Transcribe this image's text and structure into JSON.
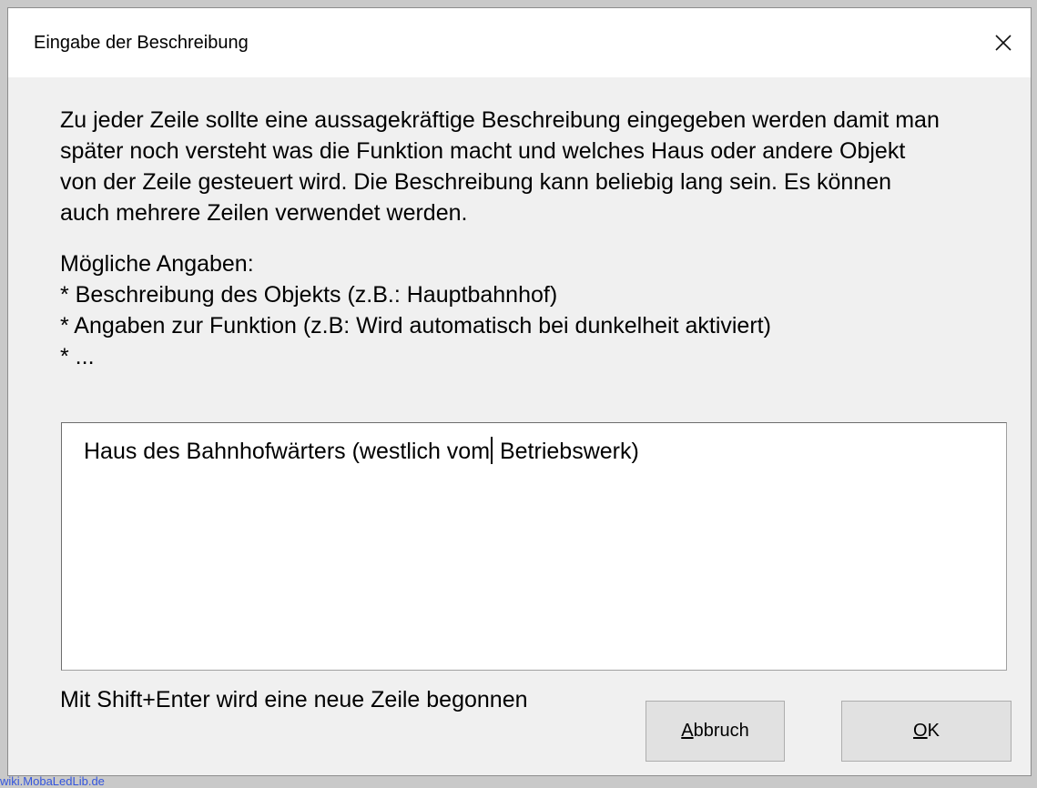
{
  "window": {
    "title": "Eingabe der Beschreibung",
    "close_icon": "close-icon"
  },
  "description": {
    "lines": [
      "Zu jeder Zeile sollte eine aussagekräftige Beschreibung eingegeben werden damit man",
      "später noch versteht was die Funktion macht und welches Haus oder andere Objekt",
      "von der Zeile gesteuert wird. Die Beschreibung kann beliebig lang sein. Es können",
      "auch mehrere Zeilen verwendet werden."
    ]
  },
  "options": {
    "heading": "Mögliche Angaben:",
    "items": [
      "* Beschreibung des Objekts (z.B.: Hauptbahnhof)",
      "* Angaben zur Funktion (z.B: Wird automatisch bei  dunkelheit aktiviert)",
      "* ..."
    ]
  },
  "input": {
    "value_before_cursor": "Haus des Bahnhofwärters (westlich vom",
    "value_after_cursor": " Betriebswerk)"
  },
  "hint": "Mit Shift+Enter wird eine neue Zeile begonnen",
  "buttons": {
    "cancel": {
      "accel": "A",
      "rest": "bbruch"
    },
    "ok": {
      "accel": "O",
      "rest": "K"
    }
  },
  "watermark": "wiki.MobaLedLib.de"
}
